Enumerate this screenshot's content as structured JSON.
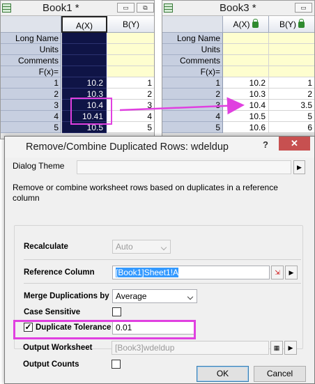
{
  "book1": {
    "title": "Book1 *",
    "col_headers": [
      "A(X)",
      "B(Y)"
    ],
    "label_rows": [
      "Long Name",
      "Units",
      "Comments",
      "F(x)="
    ],
    "row_numbers": [
      "1",
      "2",
      "3",
      "4",
      "5"
    ],
    "col_a": [
      "10.2",
      "10.3",
      "10.4",
      "10.41",
      "10.5"
    ],
    "col_b": [
      "1",
      "2",
      "3",
      "4",
      "5"
    ]
  },
  "book3": {
    "title": "Book3 *",
    "col_headers": [
      "A(X)",
      "B(Y)"
    ],
    "label_rows": [
      "Long Name",
      "Units",
      "Comments",
      "F(x)="
    ],
    "row_numbers": [
      "1",
      "2",
      "3",
      "4",
      "5"
    ],
    "col_a": [
      "10.2",
      "10.3",
      "10.4",
      "10.5",
      "10.6"
    ],
    "col_b": [
      "1",
      "2",
      "3.5",
      "5",
      "6"
    ]
  },
  "window_buttons": {
    "minimize": "▭",
    "restore": "⧉"
  },
  "dialog": {
    "title": "Remove/Combine Duplicated Rows: wdeldup",
    "help": "?",
    "close": "✕",
    "theme_label": "Dialog Theme",
    "description": "Remove or combine worksheet rows based on duplicates in a reference column",
    "recalculate_label": "Recalculate",
    "recalculate_value": "Auto",
    "reference_label": "Reference Column",
    "reference_value": "[Book1]Sheet1!A",
    "merge_label": "Merge Duplications by",
    "merge_value": "Average",
    "case_label": "Case Sensitive",
    "case_checked": false,
    "tolerance_label": "Duplicate Tolerance",
    "tolerance_checked": true,
    "tolerance_value": "0.01",
    "output_ws_label": "Output Worksheet",
    "output_ws_value": "[Book3]wdeldup",
    "output_counts_label": "Output Counts",
    "output_counts_checked": false,
    "ok_label": "OK",
    "cancel_label": "Cancel"
  },
  "colors": {
    "highlight": "#e040e0",
    "selected_column": "#0f1446",
    "label_rows": "#fefecf",
    "close_button": "#c75050"
  }
}
